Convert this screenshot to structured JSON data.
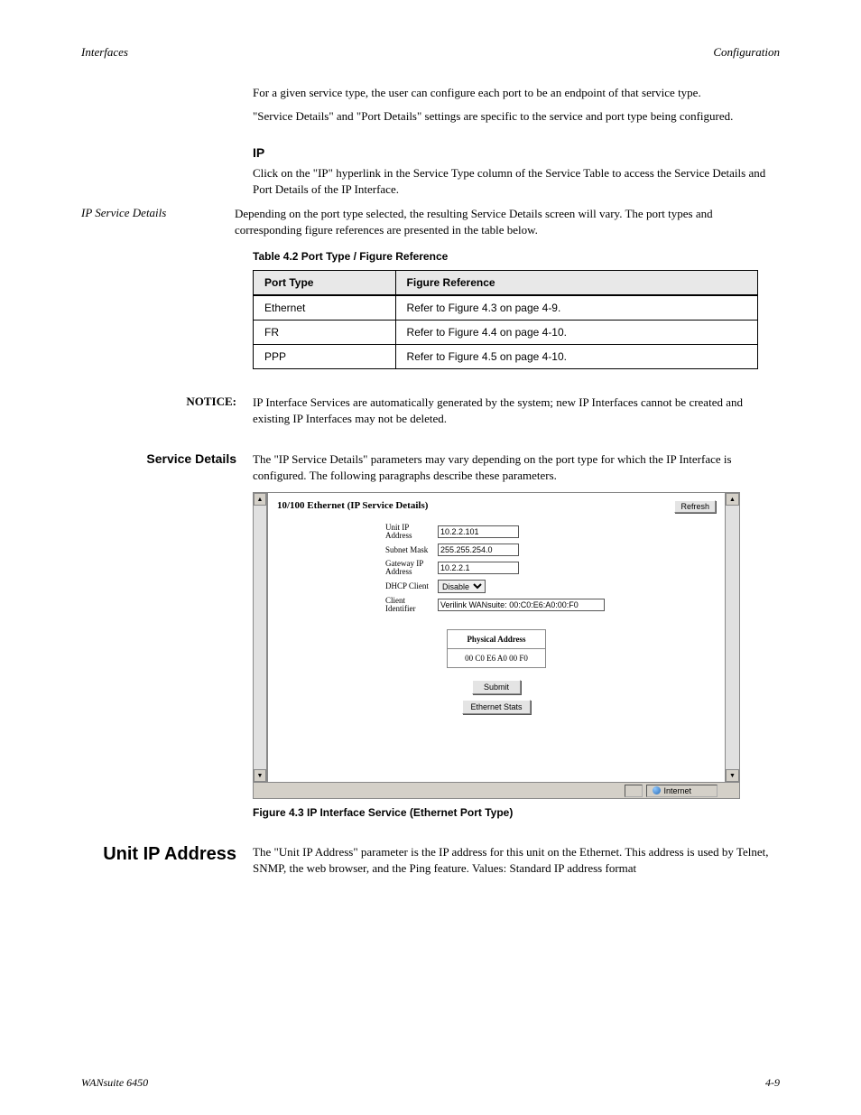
{
  "header": {
    "left": "Interfaces",
    "right": "Configuration"
  },
  "intro_paragraphs": [
    "For a given service type, the user can configure each port to be an endpoint of that service type.",
    "\"Service Details\" and \"Port Details\" settings are specific to the service and port type being configured."
  ],
  "sections": {
    "ip": {
      "title": "IP",
      "text": "Click on the \"IP\" hyperlink in the Service Type column of the Service Table to access the Service Details and Port Details of the IP Interface."
    },
    "ip_service_details": {
      "label": "IP Service Details",
      "text": "Depending on the port type selected, the resulting Service Details screen will vary. The port types and corresponding figure references are presented in the table below.",
      "table_caption": "Table 4.2   Port Type / Figure Reference",
      "table": {
        "headers": [
          "Port Type",
          "Figure Reference"
        ],
        "rows": [
          [
            "Ethernet",
            "Refer to Figure 4.3 on page 4-9."
          ],
          [
            "FR",
            "Refer to Figure 4.4 on page 4-10."
          ],
          [
            "PPP",
            "Refer to Figure 4.5 on page 4-10."
          ]
        ]
      }
    }
  },
  "side_notes": {
    "notice": {
      "label": "NOTICE:",
      "text": "IP Interface Services are automatically generated by the system; new IP Interfaces cannot be created and existing IP Interfaces may not be deleted."
    },
    "service_details": {
      "label": "Service Details",
      "text": "The \"IP Service Details\" parameters may vary depending on the port type for which the IP Interface is configured. The following paragraphs describe these parameters."
    }
  },
  "screenshot": {
    "title": "10/100 Ethernet (IP Service Details)",
    "refresh_btn": "Refresh",
    "fields": {
      "unit_ip_label": "Unit IP Address",
      "unit_ip_value": "10.2.2.101",
      "subnet_label": "Subnet Mask",
      "subnet_value": "255.255.254.0",
      "gateway_label": "Gateway IP Address",
      "gateway_value": "10.2.2.1",
      "dhcp_label": "DHCP Client",
      "dhcp_value": "Disable",
      "client_id_label": "Client Identifier",
      "client_id_value": "Verilink WANsuite: 00:C0:E6:A0:00:F0"
    },
    "physical": {
      "header": "Physical Address",
      "value": "00 C0 E6 A0 00 F0"
    },
    "buttons": {
      "submit": "Submit",
      "ethernet_stats": "Ethernet Stats"
    },
    "status_zone": "Internet"
  },
  "figure_caption": "Figure 4.3    IP Interface Service (Ethernet Port Type)",
  "unit_ip_section": {
    "heading": "Unit IP Address",
    "text": "The \"Unit IP Address\" parameter is the IP address for this unit on the Ethernet. This address is used by Telnet, SNMP, the web browser, and the Ping feature. Values: Standard IP address format"
  },
  "footer": {
    "left": "WANsuite 6450",
    "right": "4-9"
  }
}
